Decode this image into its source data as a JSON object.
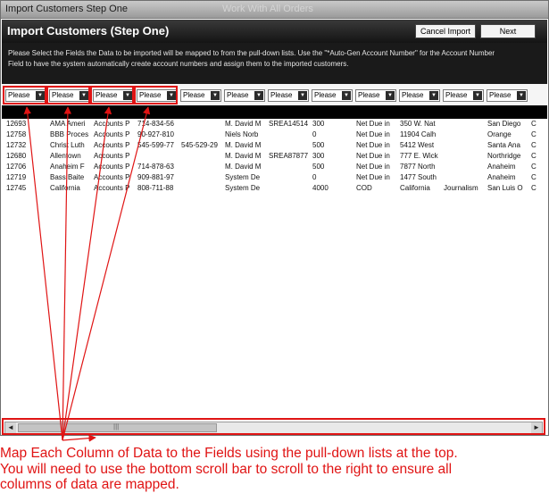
{
  "window": {
    "title": "Import Customers Step One",
    "background_title": "Work With All Orders"
  },
  "header": {
    "heading": "Import Customers (Step One)",
    "cancel_label": "Cancel Import",
    "next_label": "Next"
  },
  "instructions": {
    "line1": "Please Select the Fields the Data to be imported will be mapped to from the pull-down lists.  Use the \"*Auto-Gen Account Number\" for the Account Number",
    "line2": "Field to have the system automatically create account numbers and assign them to the imported customers."
  },
  "field_selectors": [
    {
      "value": "Please"
    },
    {
      "value": "Please"
    },
    {
      "value": "Please"
    },
    {
      "value": "Please"
    },
    {
      "value": "Please"
    },
    {
      "value": "Please"
    },
    {
      "value": "Please"
    },
    {
      "value": "Please"
    },
    {
      "value": "Please"
    },
    {
      "value": "Please"
    },
    {
      "value": "Please"
    },
    {
      "value": "Please"
    }
  ],
  "rows": [
    [
      "12693",
      "AMA Ameri",
      "Accounts P",
      "714-834-56",
      "",
      "M. David M",
      "SREA14514",
      "300",
      "Net Due in",
      "350 W. Nat",
      "",
      "San Diego",
      "C"
    ],
    [
      "12758",
      "BBB Proces",
      "Accounts P",
      "90-927-810",
      "",
      "Niels Norb",
      "",
      "0",
      "Net Due in",
      "11904 Calh",
      "",
      "Orange",
      "C"
    ],
    [
      "12732",
      "Christ Luth",
      "Accounts P",
      "545-599-77",
      "545-529-29",
      "M. David M",
      "",
      "500",
      "Net Due in",
      "5412 West",
      "",
      "Santa Ana",
      "C"
    ],
    [
      "12680",
      "Allentown",
      "Accounts P",
      "",
      "",
      "M. David M",
      "SREA87877",
      "300",
      "Net Due in",
      "777 E. Wick",
      "",
      "Northridge",
      "C"
    ],
    [
      "12706",
      "Anaheim F",
      "Accounts P",
      "714-878-63",
      "",
      "M. David M",
      "",
      "500",
      "Net Due in",
      "7877 North",
      "",
      "Anaheim",
      "C"
    ],
    [
      "12719",
      "Bass Baite",
      "Accounts P",
      "909-881-97",
      "",
      "System De",
      "",
      "0",
      "Net Due in",
      "1477 South",
      "",
      "Anaheim",
      "C"
    ],
    [
      "12745",
      "California",
      "Accounts P",
      "808-711-88",
      "",
      "System De",
      "",
      "4000",
      "COD",
      "California",
      "Journalism",
      "San Luis O",
      "C"
    ]
  ],
  "scrollbar": {
    "left_arrow": "◄",
    "right_arrow": "►",
    "grip": "|||"
  },
  "caption": {
    "line1": "Map Each Column of Data to the Fields using the pull-down lists at the top.",
    "line2": "You will need to use the bottom scroll bar to scroll to the right to ensure all",
    "line3": "columns of data are mapped."
  },
  "colors": {
    "annotation_red": "#e01414",
    "header_dark": "#1a1a1a"
  },
  "icons": {
    "dropdown": "chevron-down-icon"
  }
}
